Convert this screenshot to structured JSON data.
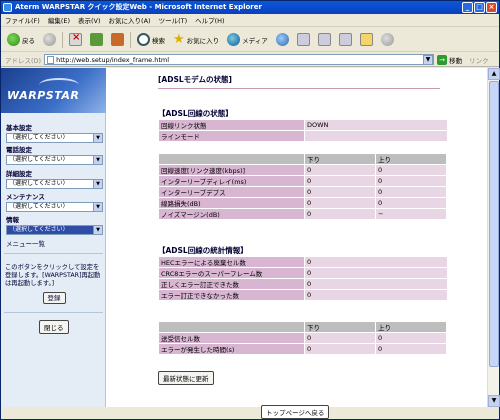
{
  "window": {
    "title": "Aterm WARPSTAR クイック設定Web - Microsoft Internet Explorer"
  },
  "menu": [
    "ファイル(F)",
    "編集(E)",
    "表示(V)",
    "お気に入り(A)",
    "ツール(T)",
    "ヘルプ(H)"
  ],
  "toolbar": {
    "back": "戻る",
    "search": "検索",
    "favorites": "お気に入り",
    "media": "メディア"
  },
  "address": {
    "label": "アドレス(D)",
    "url": "http://web.setup/index_frame.html",
    "go": "移動",
    "links": "リンク"
  },
  "sidebar": {
    "logo": "WARPSTAR",
    "groups": [
      {
        "heading": "基本設定",
        "selected": "（選択してください）"
      },
      {
        "heading": "電話設定",
        "selected": "（選択してください）"
      },
      {
        "heading": "詳細設定",
        "selected": "（選択してください）"
      },
      {
        "heading": "メンテナンス",
        "selected": "（選択してください）"
      },
      {
        "heading": "情報",
        "selected": "（選択してください）"
      }
    ],
    "menu_list": "メニュー一覧",
    "note": "このボタンをクリックして設定を登録します。[WARPSTAR]再起動は再起動します。]",
    "register": "登録",
    "close": "閉じる"
  },
  "main": {
    "page_title": "[ADSLモデムの状態]",
    "section1": "【ADSL回線の状態】",
    "link_status_label": "回線リンク状態",
    "link_status_value": "DOWN",
    "line_mode_label": "ラインモード",
    "col_down": "下り",
    "col_up": "上り",
    "rows1": [
      {
        "label": "回線速度[リンク速度(kbps)]",
        "down": "0",
        "up": "0"
      },
      {
        "label": "インターリーブディレイ(ms)",
        "down": "0",
        "up": "0"
      },
      {
        "label": "インターリーブデプス",
        "down": "0",
        "up": "0"
      },
      {
        "label": "線路損失(dB)",
        "down": "0",
        "up": "0"
      },
      {
        "label": "ノイズマージン(dB)",
        "down": "0",
        "up": "−"
      }
    ],
    "section2": "【ADSL回線の統計情報】",
    "rows2": [
      {
        "label": "HECエラーによる廃棄セル数",
        "value": "0"
      },
      {
        "label": "CRC8エラーのスーパーフレーム数",
        "value": "0"
      },
      {
        "label": "正しくエラー訂正できた数",
        "value": "0"
      },
      {
        "label": "エラー訂正できなかった数",
        "value": "0"
      }
    ],
    "rows3": [
      {
        "label": "送受信セル数",
        "down": "0",
        "up": "0"
      },
      {
        "label": "エラーが発生した時間(s)",
        "down": "0",
        "up": "0"
      }
    ],
    "update_button": "最新状態に更新",
    "top_button": "トップページへ戻る"
  }
}
